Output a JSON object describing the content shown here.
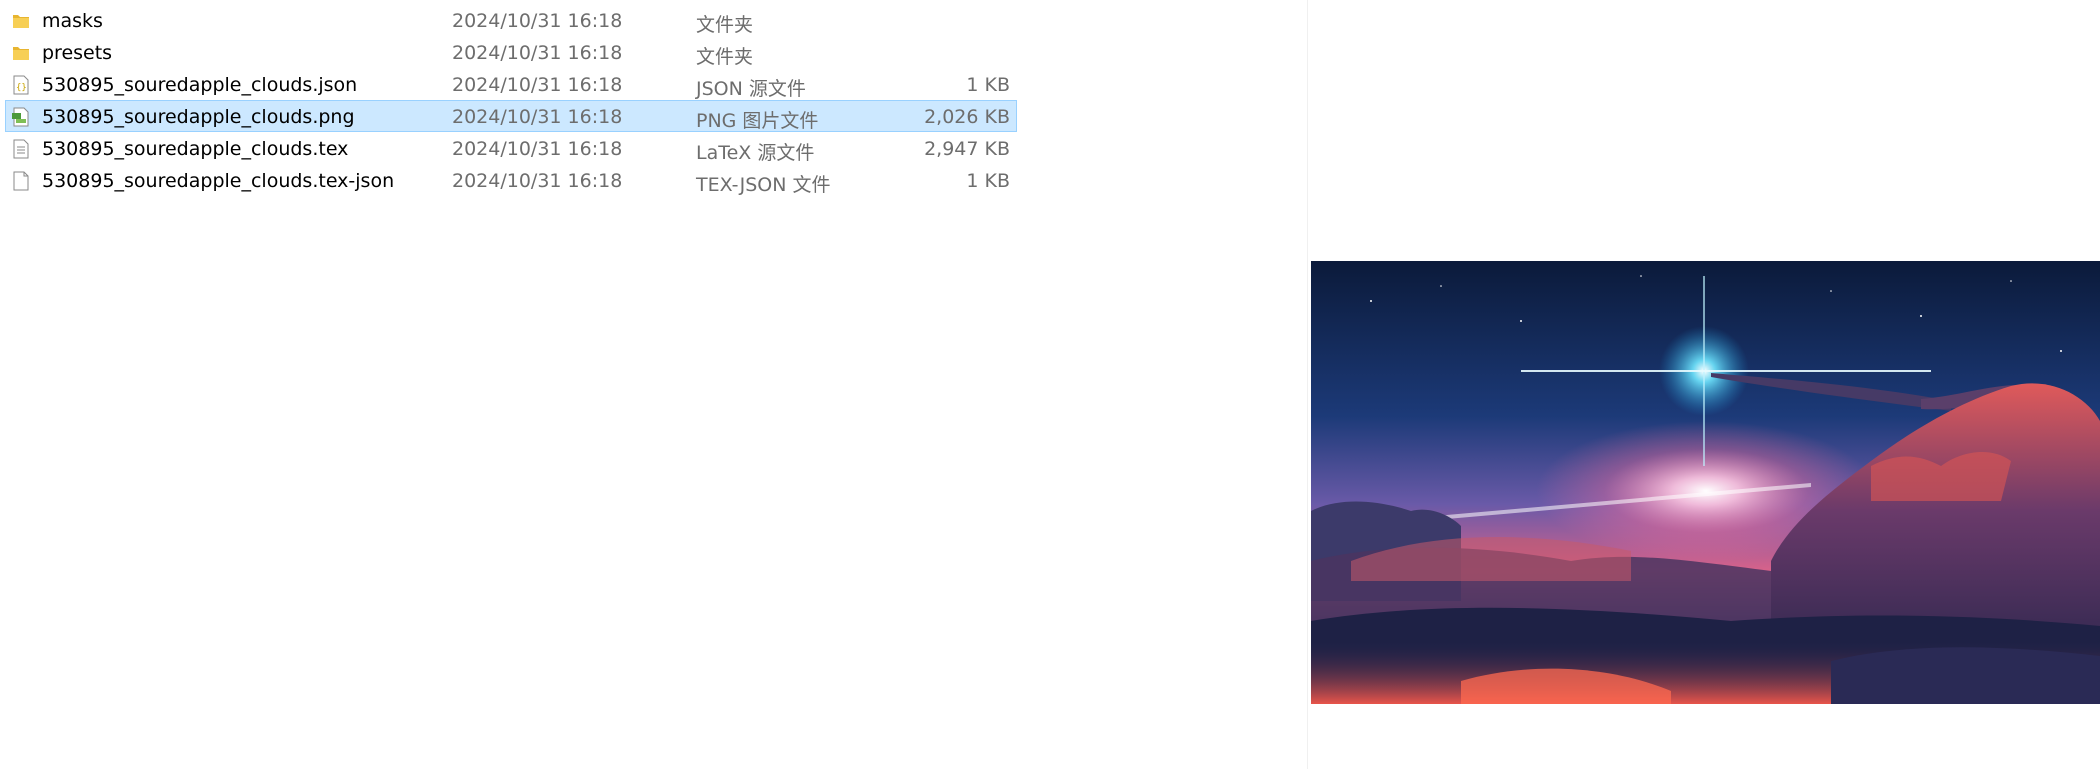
{
  "files": [
    {
      "name": "masks",
      "date": "2024/10/31 16:18",
      "type": "文件夹",
      "size": "",
      "icon": "folder-icon"
    },
    {
      "name": "presets",
      "date": "2024/10/31 16:18",
      "type": "文件夹",
      "size": "",
      "icon": "folder-icon"
    },
    {
      "name": "530895_souredapple_clouds.json",
      "date": "2024/10/31 16:18",
      "type": "JSON 源文件",
      "size": "1 KB",
      "icon": "json-file-icon"
    },
    {
      "name": "530895_souredapple_clouds.png",
      "date": "2024/10/31 16:18",
      "type": "PNG 图片文件",
      "size": "2,026 KB",
      "icon": "image-file-icon",
      "selected": true
    },
    {
      "name": "530895_souredapple_clouds.tex",
      "date": "2024/10/31 16:18",
      "type": "LaTeX 源文件",
      "size": "2,947 KB",
      "icon": "text-file-icon"
    },
    {
      "name": "530895_souredapple_clouds.tex-json",
      "date": "2024/10/31 16:18",
      "type": "TEX-JSON 文件",
      "size": "1 KB",
      "icon": "blank-file-icon"
    }
  ],
  "colors": {
    "selection_bg": "#cce8ff",
    "selection_border": "#99d1ff",
    "folder": "#f0c040",
    "meta_text": "#6d6d6d"
  }
}
